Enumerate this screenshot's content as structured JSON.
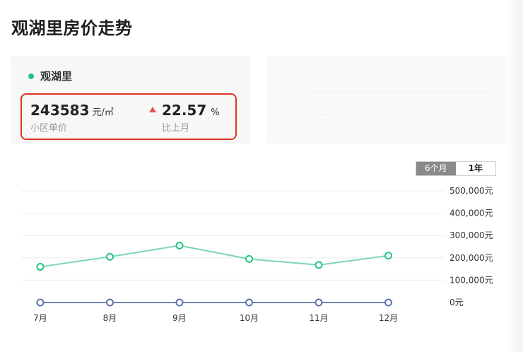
{
  "page": {
    "title": "观湖里房价走势"
  },
  "card": {
    "name": "观湖里",
    "price": {
      "value": "243583",
      "unit": "元/㎡",
      "label": "小区单价"
    },
    "change": {
      "value": "22.57",
      "unit": "%",
      "label": "比上月"
    }
  },
  "toggle": {
    "options": [
      "6个月",
      "1年"
    ],
    "active": "6个月"
  },
  "colors": {
    "accent": "#23c483",
    "series_2": "#6b84b8",
    "alert": "#e0331f",
    "up": "#e8534a"
  },
  "chart_data": {
    "type": "line",
    "categories": [
      "7月",
      "8月",
      "9月",
      "10月",
      "11月",
      "12月"
    ],
    "series": [
      {
        "values": [
          160000,
          205000,
          255000,
          195000,
          168000,
          210000
        ],
        "color": "#7dd6b0",
        "marker": "#23c483"
      },
      {
        "values": [
          0,
          0,
          0,
          0,
          0,
          0
        ],
        "color": "#6b84b8",
        "marker": "#5a73a8"
      }
    ],
    "yticks": [
      0,
      100000,
      200000,
      300000,
      400000,
      500000
    ],
    "ytick_labels": [
      "0元",
      "100,000元",
      "200,000元",
      "300,000元",
      "400,000元",
      "500,000元"
    ],
    "ylim": [
      0,
      500000
    ],
    "grid": true,
    "y_axis_position": "right"
  }
}
